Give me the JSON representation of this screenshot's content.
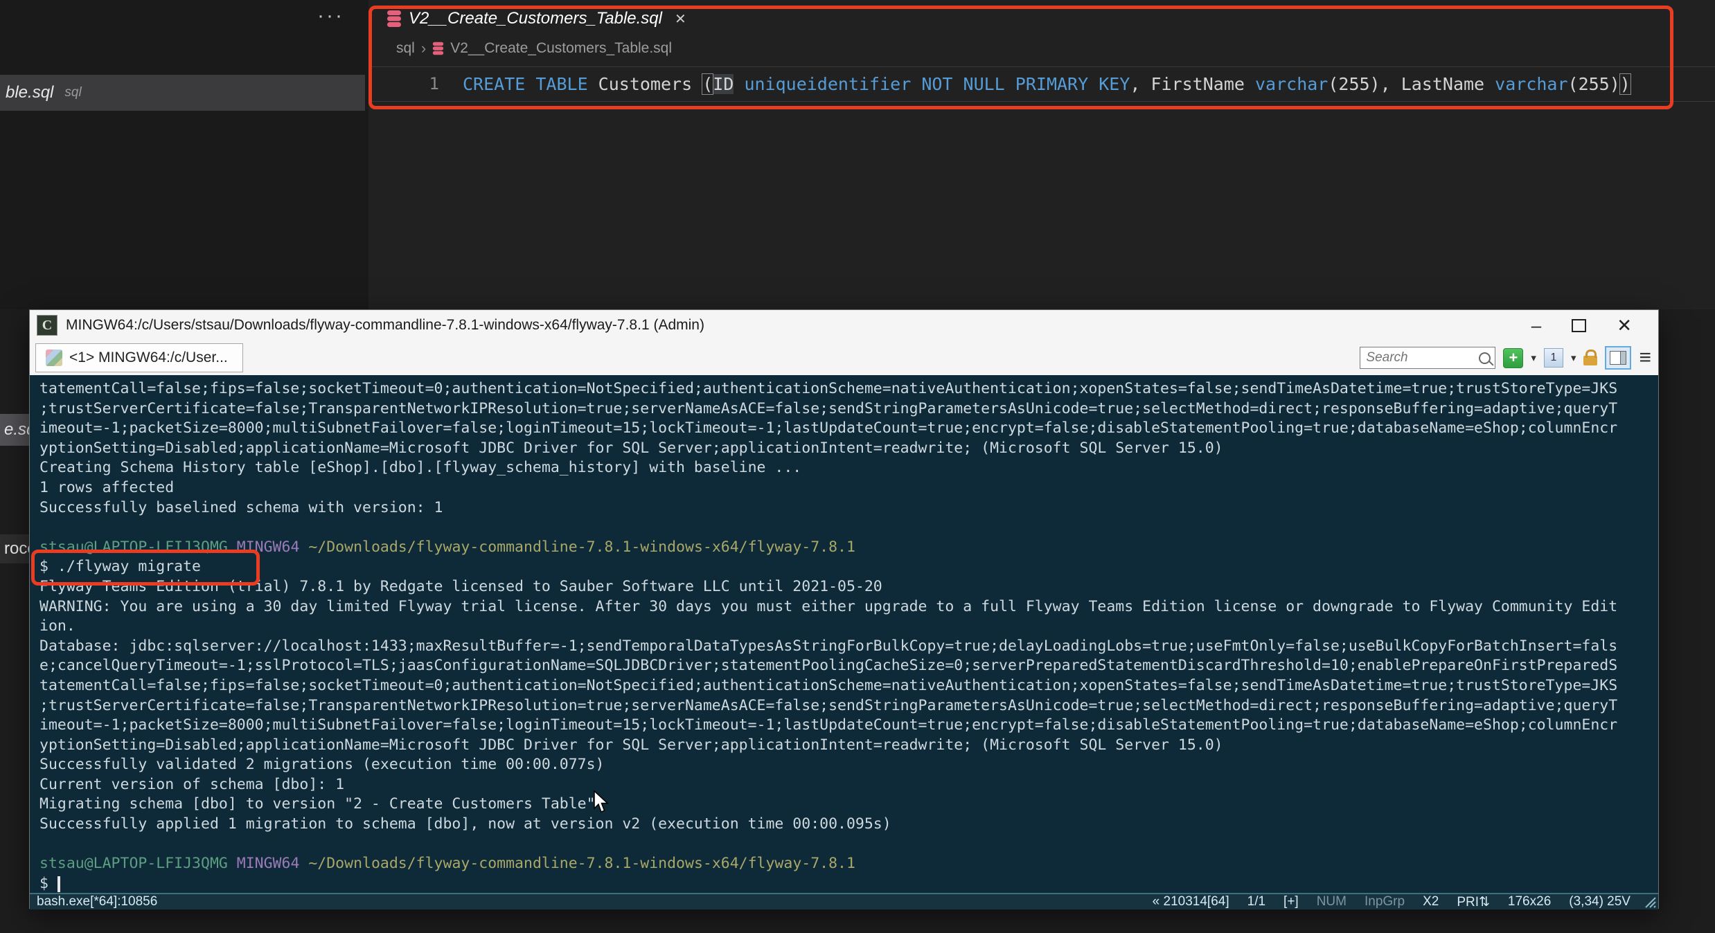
{
  "colors": {
    "annotation": "#e93d23",
    "keyword": "#569cd6",
    "terminal_bg": "#0e2937"
  },
  "icons": {
    "ellipsis": "···",
    "close": "✕",
    "minimize": "–",
    "caret": "▾",
    "menu": "≡",
    "plus": "+",
    "app_logo": "C",
    "chevron_right": "›",
    "window_number": "1"
  },
  "background_window": {
    "tab_file": "ble.sql",
    "tab_hint": "sql",
    "fragment_1": "e.sq",
    "fragment_2": "roce"
  },
  "editor": {
    "tab": {
      "file_name": "V2__Create_Customers_Table.sql"
    },
    "breadcrumb": {
      "folder": "sql",
      "file": "V2__Create_Customers_Table.sql"
    },
    "line_number": "1",
    "code_tokens": [
      [
        "CREATE TABLE",
        "kw"
      ],
      [
        " Customers ",
        "pl"
      ],
      [
        "(",
        "bx"
      ],
      [
        "ID",
        "hl"
      ],
      [
        " ",
        "pl"
      ],
      [
        "uniqueidentifier",
        "kw"
      ],
      [
        " ",
        "pl"
      ],
      [
        "NOT NULL PRIMARY KEY",
        "kw"
      ],
      [
        ", FirstName ",
        "pl"
      ],
      [
        "varchar",
        "kw"
      ],
      [
        "(255), LastName ",
        "pl"
      ],
      [
        "varchar",
        "kw"
      ],
      [
        "(255)",
        "pl"
      ],
      [
        ")",
        "bx"
      ]
    ]
  },
  "terminal": {
    "title": "MINGW64:/c/Users/stsau/Downloads/flyway-commandline-7.8.1-windows-x64/flyway-7.8.1 (Admin)",
    "tab_label": "<1> MINGW64:/c/User...",
    "toolbar": {
      "search_placeholder": "Search"
    },
    "lines": [
      {
        "seg": [
          [
            "tatementCall=false;fips=false;socketTimeout=0;authentication=NotSpecified;authenticationScheme=nativeAuthentication;xopenStates=false;sendTimeAsDatetime=true;trustStoreType=JKS"
          ]
        ]
      },
      {
        "seg": [
          [
            ";trustServerCertificate=false;TransparentNetworkIPResolution=true;serverNameAsACE=false;sendStringParametersAsUnicode=true;selectMethod=direct;responseBuffering=adaptive;queryT"
          ]
        ]
      },
      {
        "seg": [
          [
            "imeout=-1;packetSize=8000;multiSubnetFailover=false;loginTimeout=15;lockTimeout=-1;lastUpdateCount=true;encrypt=false;disableStatementPooling=true;databaseName=eShop;columnEncr"
          ]
        ]
      },
      {
        "seg": [
          [
            "yptionSetting=Disabled;applicationName=Microsoft JDBC Driver for SQL Server;applicationIntent=readwrite; (Microsoft SQL Server 15.0)"
          ]
        ]
      },
      {
        "seg": [
          [
            "Creating Schema History table [eShop].[dbo].[flyway_schema_history] with baseline ..."
          ]
        ]
      },
      {
        "seg": [
          [
            "1 rows affected"
          ]
        ]
      },
      {
        "seg": [
          [
            "Successfully baselined schema with version: 1"
          ]
        ]
      },
      {
        "seg": []
      },
      {
        "seg": [
          [
            "stsau@LAPTOP-LFIJ3QMG",
            "green"
          ],
          [
            " "
          ],
          [
            "MINGW64",
            "purple"
          ],
          [
            " "
          ],
          [
            "~/Downloads/flyway-commandline-7.8.1-windows-x64/flyway-7.8.1",
            "olive"
          ]
        ]
      },
      {
        "seg": [
          [
            "$ ./flyway migrate"
          ]
        ]
      },
      {
        "seg": [
          [
            "Flyway Teams Edition (trial) 7.8.1 by Redgate licensed to Sauber Software LLC until 2021-05-20"
          ]
        ]
      },
      {
        "seg": [
          [
            "WARNING: You are using a 30 day limited Flyway trial license. After 30 days you must either upgrade to a full Flyway Teams Edition license or downgrade to Flyway Community Edit"
          ]
        ]
      },
      {
        "seg": [
          [
            "ion."
          ]
        ]
      },
      {
        "seg": [
          [
            "Database: jdbc:sqlserver://localhost:1433;maxResultBuffer=-1;sendTemporalDataTypesAsStringForBulkCopy=true;delayLoadingLobs=true;useFmtOnly=false;useBulkCopyForBatchInsert=fals"
          ]
        ]
      },
      {
        "seg": [
          [
            "e;cancelQueryTimeout=-1;sslProtocol=TLS;jaasConfigurationName=SQLJDBCDriver;statementPoolingCacheSize=0;serverPreparedStatementDiscardThreshold=10;enablePrepareOnFirstPreparedS"
          ]
        ]
      },
      {
        "seg": [
          [
            "tatementCall=false;fips=false;socketTimeout=0;authentication=NotSpecified;authenticationScheme=nativeAuthentication;xopenStates=false;sendTimeAsDatetime=true;trustStoreType=JKS"
          ]
        ]
      },
      {
        "seg": [
          [
            ";trustServerCertificate=false;TransparentNetworkIPResolution=true;serverNameAsACE=false;sendStringParametersAsUnicode=true;selectMethod=direct;responseBuffering=adaptive;queryT"
          ]
        ]
      },
      {
        "seg": [
          [
            "imeout=-1;packetSize=8000;multiSubnetFailover=false;loginTimeout=15;lockTimeout=-1;lastUpdateCount=true;encrypt=false;disableStatementPooling=true;databaseName=eShop;columnEncr"
          ]
        ]
      },
      {
        "seg": [
          [
            "yptionSetting=Disabled;applicationName=Microsoft JDBC Driver for SQL Server;applicationIntent=readwrite; (Microsoft SQL Server 15.0)"
          ]
        ]
      },
      {
        "seg": [
          [
            "Successfully validated 2 migrations (execution time 00:00.077s)"
          ]
        ]
      },
      {
        "seg": [
          [
            "Current version of schema [dbo]: 1"
          ]
        ]
      },
      {
        "seg": [
          [
            "Migrating schema [dbo] to version \"2 - Create Customers Table\""
          ]
        ]
      },
      {
        "seg": [
          [
            "Successfully applied 1 migration to schema [dbo], now at version v2 (execution time 00:00.095s)"
          ]
        ]
      },
      {
        "seg": []
      },
      {
        "seg": [
          [
            "stsau@LAPTOP-LFIJ3QMG",
            "green"
          ],
          [
            " "
          ],
          [
            "MINGW64",
            "purple"
          ],
          [
            " "
          ],
          [
            "~/Downloads/flyway-commandline-7.8.1-windows-x64/flyway-7.8.1",
            "olive"
          ]
        ]
      },
      {
        "seg": [
          [
            "$ "
          ]
        ],
        "cursor": true
      }
    ],
    "status_bar": {
      "left": "bash.exe[*64]:10856",
      "right": [
        {
          "t": "« 210314[64]"
        },
        {
          "t": "1/1"
        },
        {
          "t": "[+]"
        },
        {
          "t": "NUM",
          "dim": true
        },
        {
          "t": "InpGrp",
          "dim": true
        },
        {
          "t": "X2"
        },
        {
          "t": "PRI⇅"
        },
        {
          "t": "176x26"
        },
        {
          "t": "(3,34) 25V"
        }
      ]
    }
  }
}
